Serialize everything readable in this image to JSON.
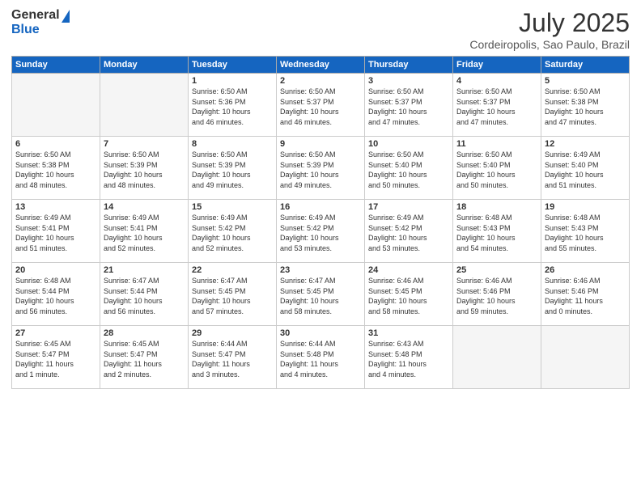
{
  "logo": {
    "general": "General",
    "blue": "Blue"
  },
  "title": "July 2025",
  "location": "Cordeiropolis, Sao Paulo, Brazil",
  "headers": [
    "Sunday",
    "Monday",
    "Tuesday",
    "Wednesday",
    "Thursday",
    "Friday",
    "Saturday"
  ],
  "weeks": [
    [
      {
        "day": "",
        "info": ""
      },
      {
        "day": "",
        "info": ""
      },
      {
        "day": "1",
        "info": "Sunrise: 6:50 AM\nSunset: 5:36 PM\nDaylight: 10 hours\nand 46 minutes."
      },
      {
        "day": "2",
        "info": "Sunrise: 6:50 AM\nSunset: 5:37 PM\nDaylight: 10 hours\nand 46 minutes."
      },
      {
        "day": "3",
        "info": "Sunrise: 6:50 AM\nSunset: 5:37 PM\nDaylight: 10 hours\nand 47 minutes."
      },
      {
        "day": "4",
        "info": "Sunrise: 6:50 AM\nSunset: 5:37 PM\nDaylight: 10 hours\nand 47 minutes."
      },
      {
        "day": "5",
        "info": "Sunrise: 6:50 AM\nSunset: 5:38 PM\nDaylight: 10 hours\nand 47 minutes."
      }
    ],
    [
      {
        "day": "6",
        "info": "Sunrise: 6:50 AM\nSunset: 5:38 PM\nDaylight: 10 hours\nand 48 minutes."
      },
      {
        "day": "7",
        "info": "Sunrise: 6:50 AM\nSunset: 5:39 PM\nDaylight: 10 hours\nand 48 minutes."
      },
      {
        "day": "8",
        "info": "Sunrise: 6:50 AM\nSunset: 5:39 PM\nDaylight: 10 hours\nand 49 minutes."
      },
      {
        "day": "9",
        "info": "Sunrise: 6:50 AM\nSunset: 5:39 PM\nDaylight: 10 hours\nand 49 minutes."
      },
      {
        "day": "10",
        "info": "Sunrise: 6:50 AM\nSunset: 5:40 PM\nDaylight: 10 hours\nand 50 minutes."
      },
      {
        "day": "11",
        "info": "Sunrise: 6:50 AM\nSunset: 5:40 PM\nDaylight: 10 hours\nand 50 minutes."
      },
      {
        "day": "12",
        "info": "Sunrise: 6:49 AM\nSunset: 5:40 PM\nDaylight: 10 hours\nand 51 minutes."
      }
    ],
    [
      {
        "day": "13",
        "info": "Sunrise: 6:49 AM\nSunset: 5:41 PM\nDaylight: 10 hours\nand 51 minutes."
      },
      {
        "day": "14",
        "info": "Sunrise: 6:49 AM\nSunset: 5:41 PM\nDaylight: 10 hours\nand 52 minutes."
      },
      {
        "day": "15",
        "info": "Sunrise: 6:49 AM\nSunset: 5:42 PM\nDaylight: 10 hours\nand 52 minutes."
      },
      {
        "day": "16",
        "info": "Sunrise: 6:49 AM\nSunset: 5:42 PM\nDaylight: 10 hours\nand 53 minutes."
      },
      {
        "day": "17",
        "info": "Sunrise: 6:49 AM\nSunset: 5:42 PM\nDaylight: 10 hours\nand 53 minutes."
      },
      {
        "day": "18",
        "info": "Sunrise: 6:48 AM\nSunset: 5:43 PM\nDaylight: 10 hours\nand 54 minutes."
      },
      {
        "day": "19",
        "info": "Sunrise: 6:48 AM\nSunset: 5:43 PM\nDaylight: 10 hours\nand 55 minutes."
      }
    ],
    [
      {
        "day": "20",
        "info": "Sunrise: 6:48 AM\nSunset: 5:44 PM\nDaylight: 10 hours\nand 56 minutes."
      },
      {
        "day": "21",
        "info": "Sunrise: 6:47 AM\nSunset: 5:44 PM\nDaylight: 10 hours\nand 56 minutes."
      },
      {
        "day": "22",
        "info": "Sunrise: 6:47 AM\nSunset: 5:45 PM\nDaylight: 10 hours\nand 57 minutes."
      },
      {
        "day": "23",
        "info": "Sunrise: 6:47 AM\nSunset: 5:45 PM\nDaylight: 10 hours\nand 58 minutes."
      },
      {
        "day": "24",
        "info": "Sunrise: 6:46 AM\nSunset: 5:45 PM\nDaylight: 10 hours\nand 58 minutes."
      },
      {
        "day": "25",
        "info": "Sunrise: 6:46 AM\nSunset: 5:46 PM\nDaylight: 10 hours\nand 59 minutes."
      },
      {
        "day": "26",
        "info": "Sunrise: 6:46 AM\nSunset: 5:46 PM\nDaylight: 11 hours\nand 0 minutes."
      }
    ],
    [
      {
        "day": "27",
        "info": "Sunrise: 6:45 AM\nSunset: 5:47 PM\nDaylight: 11 hours\nand 1 minute."
      },
      {
        "day": "28",
        "info": "Sunrise: 6:45 AM\nSunset: 5:47 PM\nDaylight: 11 hours\nand 2 minutes."
      },
      {
        "day": "29",
        "info": "Sunrise: 6:44 AM\nSunset: 5:47 PM\nDaylight: 11 hours\nand 3 minutes."
      },
      {
        "day": "30",
        "info": "Sunrise: 6:44 AM\nSunset: 5:48 PM\nDaylight: 11 hours\nand 4 minutes."
      },
      {
        "day": "31",
        "info": "Sunrise: 6:43 AM\nSunset: 5:48 PM\nDaylight: 11 hours\nand 4 minutes."
      },
      {
        "day": "",
        "info": ""
      },
      {
        "day": "",
        "info": ""
      }
    ]
  ]
}
